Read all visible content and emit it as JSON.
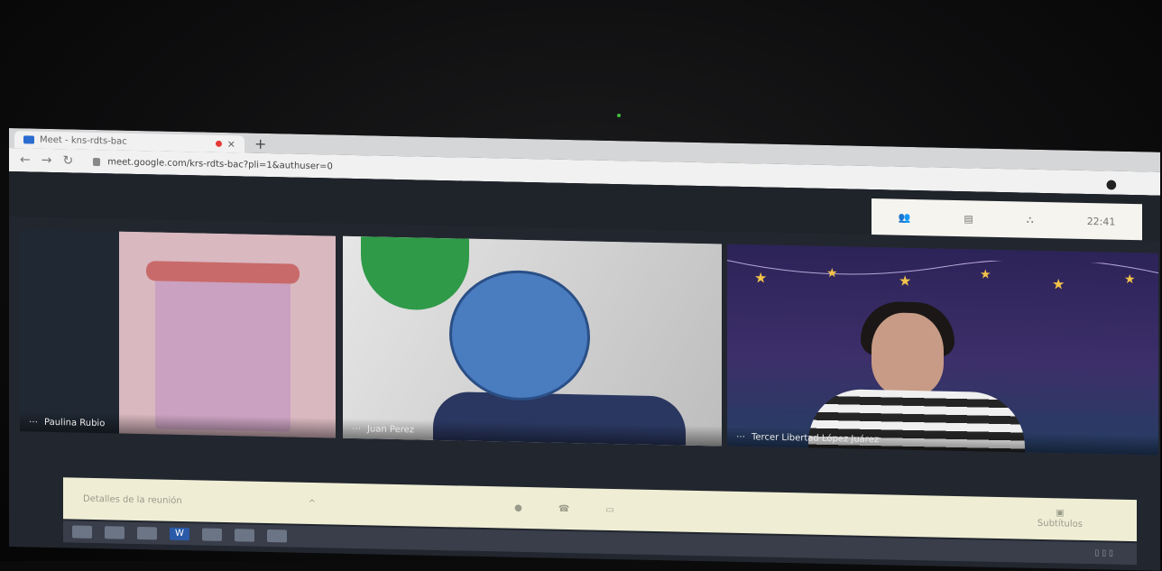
{
  "browser": {
    "tab_title": "Meet - kns-rdts-bac",
    "url": "meet.google.com/krs-rdts-bac?pli=1&authuser=0",
    "new_tab_symbol": "+",
    "close_symbol": "×"
  },
  "meet_header": {
    "time": "22:41"
  },
  "participants": [
    {
      "name": "Paulina Rubio",
      "more": "⋯"
    },
    {
      "name": "Juan Perez",
      "more": "⋯"
    },
    {
      "name": "Tercer Libertad López Juárez",
      "more": "⋯"
    }
  ],
  "controls": {
    "meeting_details": "Detalles de la reunión",
    "captions": "Subtítulos"
  },
  "colors": {
    "privacy_blob": "#4a7cc0",
    "recording_dot": "#e53935"
  }
}
